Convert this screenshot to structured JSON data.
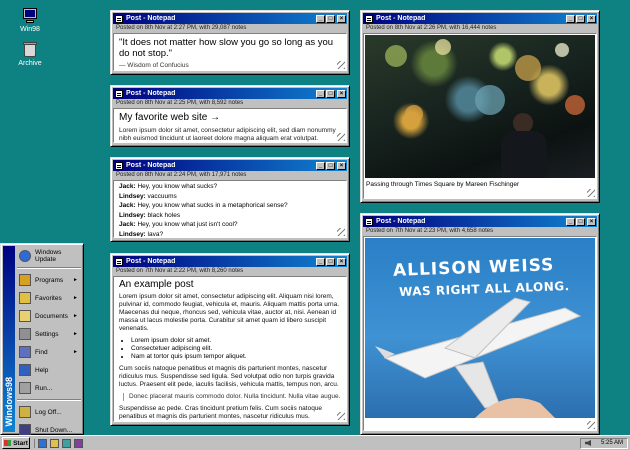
{
  "desktop": {
    "icons": [
      {
        "label": "Win98",
        "icon": "computer-icon"
      },
      {
        "label": "Archive",
        "icon": "recycle-bin-icon"
      }
    ]
  },
  "window_controls": {
    "minimize": "_",
    "maximize": "□",
    "close": "×"
  },
  "windows": [
    {
      "title": "Post - Notepad",
      "meta": "Posted on 8th Nov at 2:27 PM, with 29,087 notes",
      "quote": "\"It does not matter how slow you go so long as you do not stop.\"",
      "attribution": "— Wisdom of Confucius"
    },
    {
      "title": "Post - Notepad",
      "meta": "Posted on 8th Nov at 2:25 PM, with 8,592 notes",
      "link_title": "My favorite web site →",
      "body": "Lorem ipsum dolor sit amet, consectetur adipiscing elit, sed diam nonummy nibh euismod tincidunt ut laoreet dolore magna aliquam erat volutpat."
    },
    {
      "title": "Post - Notepad",
      "meta": "Posted on 8th Nov at 2:24 PM, with 17,971 notes",
      "chat": [
        {
          "speaker": "Jack:",
          "line": "Hey, you know what sucks?"
        },
        {
          "speaker": "Lindsey:",
          "line": "vaccuums"
        },
        {
          "speaker": "Jack:",
          "line": "Hey, you know what sucks in a metaphorical sense?"
        },
        {
          "speaker": "Lindsey:",
          "line": "black holes"
        },
        {
          "speaker": "Jack:",
          "line": "Hey, you know what just isn't cool?"
        },
        {
          "speaker": "Lindsey:",
          "line": "lava?"
        }
      ]
    },
    {
      "title": "Post - Notepad",
      "meta": "Posted on 7th Nov at 2:22 PM, with 8,260 notes",
      "heading": "An example post",
      "p1": "Lorem ipsum dolor sit amet, consectetur adipiscing elit. Aliquam nisi lorem, pulvinar id, commodo feugiat, vehicula et, mauris. Aliquam mattis porta urna. Maecenas dui neque, rhoncus sed, vehicula vitae, auctor at, nisi. Aenean id massa ut lacus molestie porta. Curabitur sit amet quam id libero suscipit venenatis.",
      "bullets": [
        "Lorem ipsum dolor sit amet.",
        "Consectetuer adipiscing elit.",
        "Nam at tortor quis ipsum tempor aliquet."
      ],
      "p2": "Cum sociis natoque penatibus et magnis dis parturient montes, nascetur ridiculus mus. Suspendisse sed ligula. Sed volutpat odio non turpis gravida luctus. Praesent elit pede, iaculis facilisis, vehicula mattis, tempus non, arcu.",
      "blockquote": "Donec placerat mauris commodo dolor. Nulla tincidunt. Nulla vitae augue.",
      "p3": "Suspendisse ac pede. Cras tincidunt pretium felis. Cum sociis natoque penatibus et magnis dis parturient montes, nascetur ridiculus mus. Pellentesque porttitor id felis. Maecenas nec augue. Praesent a quam pretium leo congue accumsan."
    },
    {
      "title": "Post - Notepad",
      "meta": "Posted on 8th Nov at 2:26 PM, with 16,444 notes",
      "caption": "Passing through Times Square by Mareen Fischinger"
    },
    {
      "title": "Post - Notepad",
      "meta": "Posted on 7th Nov at 2:23 PM, with 4,658 notes",
      "poster_line1": "ALLISON WEISS",
      "poster_line2": "WAS RIGHT ALL ALONG."
    }
  ],
  "start_menu": {
    "banner": "Windows98",
    "items": [
      {
        "label": "Windows Update",
        "icon": "globe-icon",
        "color": "#2b6cd6",
        "arrow": ""
      },
      {
        "label": "Programs",
        "icon": "programs-icon",
        "color": "#d8a020",
        "arrow": "►"
      },
      {
        "label": "Favorites",
        "icon": "favorites-folder-icon",
        "color": "#e0c040",
        "arrow": "►"
      },
      {
        "label": "Documents",
        "icon": "documents-icon",
        "color": "#e8d070",
        "arrow": "►"
      },
      {
        "label": "Settings",
        "icon": "settings-icon",
        "color": "#909090",
        "arrow": "►"
      },
      {
        "label": "Find",
        "icon": "find-icon",
        "color": "#6070c0",
        "arrow": "►"
      },
      {
        "label": "Help",
        "icon": "help-icon",
        "color": "#3060c0",
        "arrow": ""
      },
      {
        "label": "Run...",
        "icon": "run-icon",
        "color": "#a0a0a0",
        "arrow": ""
      },
      {
        "label": "Log Off...",
        "icon": "log-off-icon",
        "color": "#d0b040",
        "arrow": ""
      },
      {
        "label": "Shut Down...",
        "icon": "shut-down-icon",
        "color": "#404080",
        "arrow": ""
      }
    ]
  },
  "taskbar": {
    "start_label": "Start",
    "quick_launch": [
      "ie-icon",
      "outlook-icon",
      "desktop-icon",
      "channels-icon"
    ],
    "clock": "5:25 AM"
  }
}
